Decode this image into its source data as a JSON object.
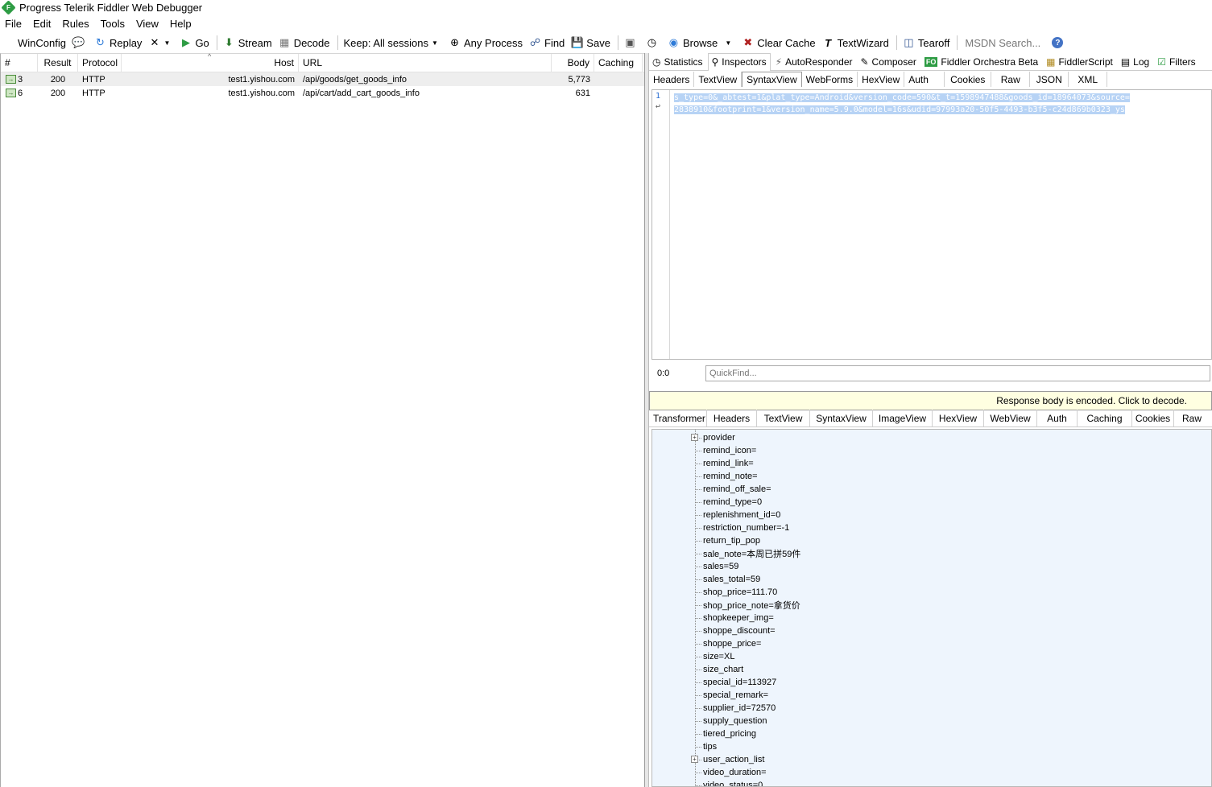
{
  "window": {
    "title": "Progress Telerik Fiddler Web Debugger",
    "logo_letter": "F"
  },
  "menu": [
    "File",
    "Edit",
    "Rules",
    "Tools",
    "View",
    "Help"
  ],
  "toolbar": {
    "winconfig": "WinConfig",
    "replay": "Replay",
    "go": "Go",
    "stream": "Stream",
    "decode": "Decode",
    "keep": "Keep: All sessions",
    "process": "Any Process",
    "find": "Find",
    "save": "Save",
    "browse": "Browse",
    "clear_cache": "Clear Cache",
    "textwizard": "TextWizard",
    "tearoff": "Tearoff",
    "search_placeholder": "MSDN Search..."
  },
  "sessions": {
    "columns": {
      "num": "#",
      "result": "Result",
      "protocol": "Protocol",
      "host": "Host",
      "url": "URL",
      "body": "Body",
      "caching": "Caching"
    },
    "rows": [
      {
        "num": "3",
        "result": "200",
        "protocol": "HTTP",
        "host": "test1.yishou.com",
        "url": "/api/goods/get_goods_info",
        "body": "5,773",
        "caching": ""
      },
      {
        "num": "6",
        "result": "200",
        "protocol": "HTTP",
        "host": "test1.yishou.com",
        "url": "/api/cart/add_cart_goods_info",
        "body": "631",
        "caching": ""
      }
    ]
  },
  "main_tabs": [
    "Statistics",
    "Inspectors",
    "AutoResponder",
    "Composer",
    "Fiddler Orchestra Beta",
    "FiddlerScript",
    "Log",
    "Filters"
  ],
  "fo_badge": "FO",
  "request_tabs": [
    "Headers",
    "TextView",
    "SyntaxView",
    "WebForms",
    "HexView",
    "Auth",
    "Cookies",
    "Raw",
    "JSON",
    "XML"
  ],
  "editor": {
    "line_number": "1",
    "line1": "s_type=0&_abtest=1&plat_type=Android&version_code=590&t_t=1598947488&goods_id=18964073&source=",
    "line2": "2838910&footprint=1&version_name=5.9.0&model=16s&udid=97993a20-50f5-4493-b3f5-c24d869b0323_ys"
  },
  "status": {
    "cursor": "0:0",
    "quickfind_placeholder": "QuickFind..."
  },
  "encoded_notice": "Response body is encoded. Click to decode.",
  "response_tabs": [
    "Transformer",
    "Headers",
    "TextView",
    "SyntaxView",
    "ImageView",
    "HexView",
    "WebView",
    "Auth",
    "Caching",
    "Cookies",
    "Raw"
  ],
  "tree": [
    {
      "text": "provider",
      "expandable": true
    },
    {
      "text": "remind_icon="
    },
    {
      "text": "remind_link="
    },
    {
      "text": "remind_note="
    },
    {
      "text": "remind_off_sale="
    },
    {
      "text": "remind_type=0"
    },
    {
      "text": "replenishment_id=0"
    },
    {
      "text": "restriction_number=-1"
    },
    {
      "text": "return_tip_pop"
    },
    {
      "text": "sale_note=本周已拼59件"
    },
    {
      "text": "sales=59"
    },
    {
      "text": "sales_total=59"
    },
    {
      "text": "shop_price=111.70"
    },
    {
      "text": "shop_price_note=拿货价"
    },
    {
      "text": "shopkeeper_img="
    },
    {
      "text": "shoppe_discount="
    },
    {
      "text": "shoppe_price="
    },
    {
      "text": "size=XL"
    },
    {
      "text": "size_chart"
    },
    {
      "text": "special_id=113927"
    },
    {
      "text": "special_remark="
    },
    {
      "text": "supplier_id=72570"
    },
    {
      "text": "supply_question"
    },
    {
      "text": "tiered_pricing"
    },
    {
      "text": "tips"
    },
    {
      "text": "user_action_list",
      "expandable": true
    },
    {
      "text": "video_duration="
    },
    {
      "text": "video_status=0"
    }
  ]
}
